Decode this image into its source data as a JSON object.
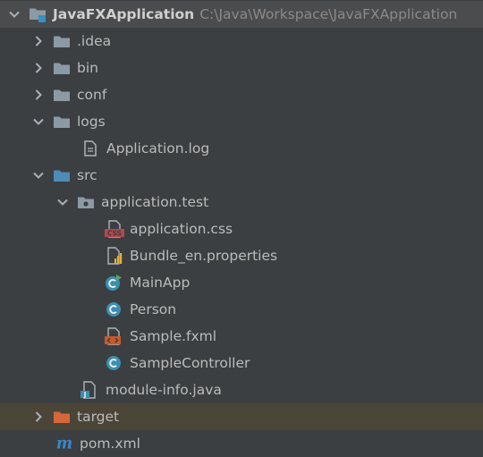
{
  "project": {
    "name": "JavaFXApplication",
    "path": "C:\\Java\\Workspace\\JavaFXApplication"
  },
  "tree": {
    "idea": ".idea",
    "bin": "bin",
    "conf": "conf",
    "logs": "logs",
    "application_log": "Application.log",
    "src": "src",
    "package": "application.test",
    "application_css": "application.css",
    "bundle": "Bundle_en.properties",
    "mainapp": "MainApp",
    "person": "Person",
    "sample_fxml": "Sample.fxml",
    "sample_controller": "SampleController",
    "module_info": "module-info.java",
    "target": "target",
    "pom": "pom.xml"
  },
  "colors": {
    "background": "#3c3f41",
    "folder": "#8c9aa6",
    "source_folder": "#4d8cb8",
    "excluded_folder": "#d6673a",
    "class_icon": "#3b8fb0",
    "maven": "#3a86c8"
  }
}
